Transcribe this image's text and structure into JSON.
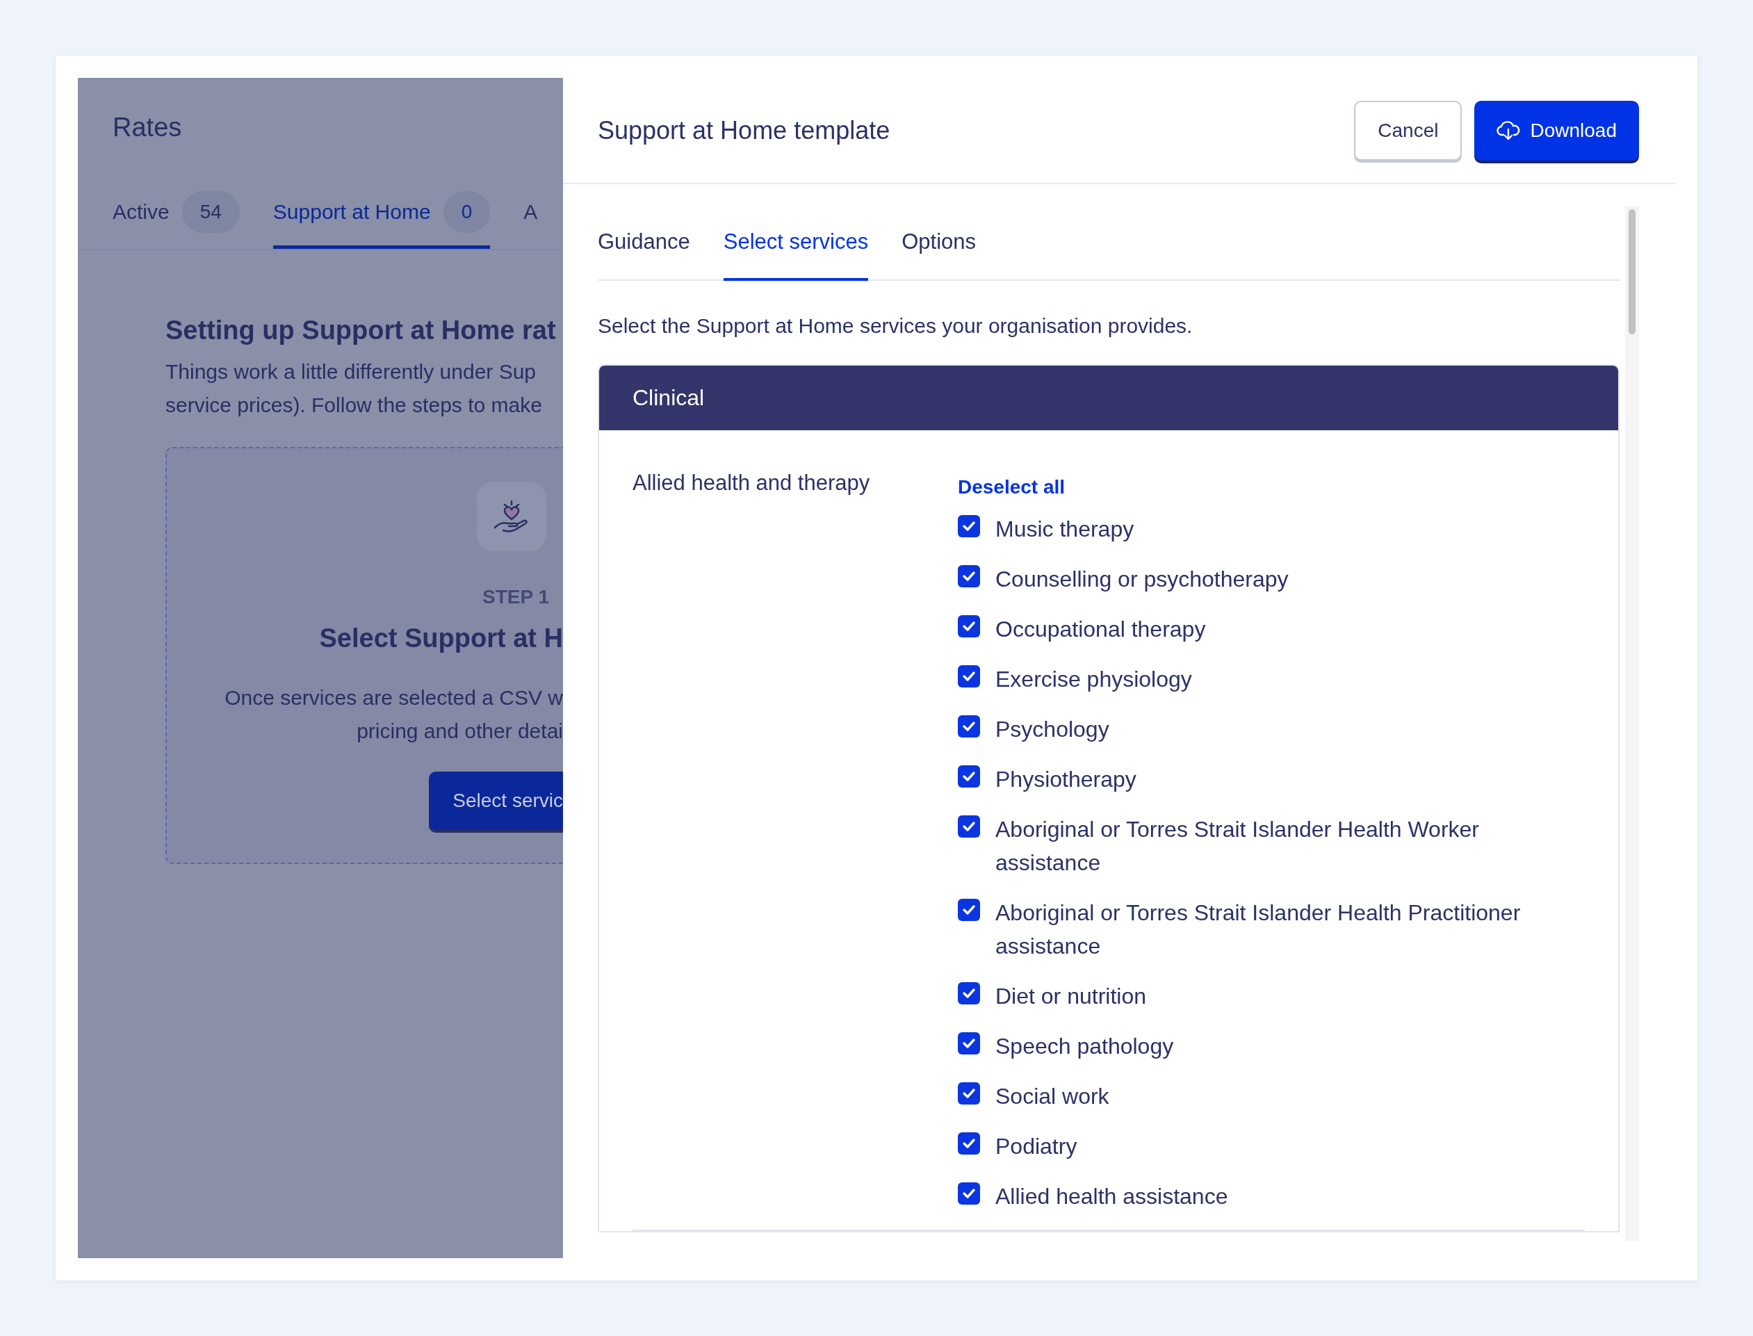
{
  "background_page": {
    "title": "Rates",
    "tabs": [
      {
        "label": "Active",
        "count": "54",
        "selected": false
      },
      {
        "label": "Support at Home",
        "count": "0",
        "selected": true
      },
      {
        "label": "A",
        "selected": false
      }
    ],
    "heading": "Setting up Support at Home rat",
    "intro_lines": [
      "Things work a little differently under Sup",
      "service prices). Follow the steps to make"
    ],
    "step_card": {
      "step": "STEP 1",
      "title": "Select Support at H",
      "description_lines": [
        "Once services are selected a CSV w",
        "pricing and other detai"
      ],
      "button": "Select servic"
    }
  },
  "drawer": {
    "title": "Support at Home template",
    "buttons": [
      {
        "label": "Cancel",
        "kind": "secondary"
      },
      {
        "label": "Download",
        "kind": "primary"
      }
    ],
    "tabs": [
      {
        "label": "Guidance",
        "selected": false
      },
      {
        "label": "Select services",
        "selected": true
      },
      {
        "label": "Options",
        "selected": false
      }
    ],
    "description": "Select the Support at Home services your organisation provides.",
    "sections": [
      {
        "title": "Clinical",
        "groups": [
          {
            "name": "Allied health and therapy",
            "action": "Deselect all",
            "services": [
              {
                "label": "Music therapy",
                "checked": true
              },
              {
                "label": "Counselling or psychotherapy",
                "checked": true
              },
              {
                "label": "Occupational therapy",
                "checked": true
              },
              {
                "label": "Exercise physiology",
                "checked": true
              },
              {
                "label": "Psychology",
                "checked": true
              },
              {
                "label": "Physiotherapy",
                "checked": true
              },
              {
                "label": "Aboriginal or Torres Strait Islander Health Worker assistance",
                "checked": true
              },
              {
                "label": "Aboriginal or Torres Strait Islander Health Practitioner assistance",
                "checked": true
              },
              {
                "label": "Diet or nutrition",
                "checked": true
              },
              {
                "label": "Speech pathology",
                "checked": true
              },
              {
                "label": "Social work",
                "checked": true
              },
              {
                "label": "Podiatry",
                "checked": true
              },
              {
                "label": "Allied health assistance",
                "checked": true
              }
            ]
          }
        ]
      }
    ]
  }
}
